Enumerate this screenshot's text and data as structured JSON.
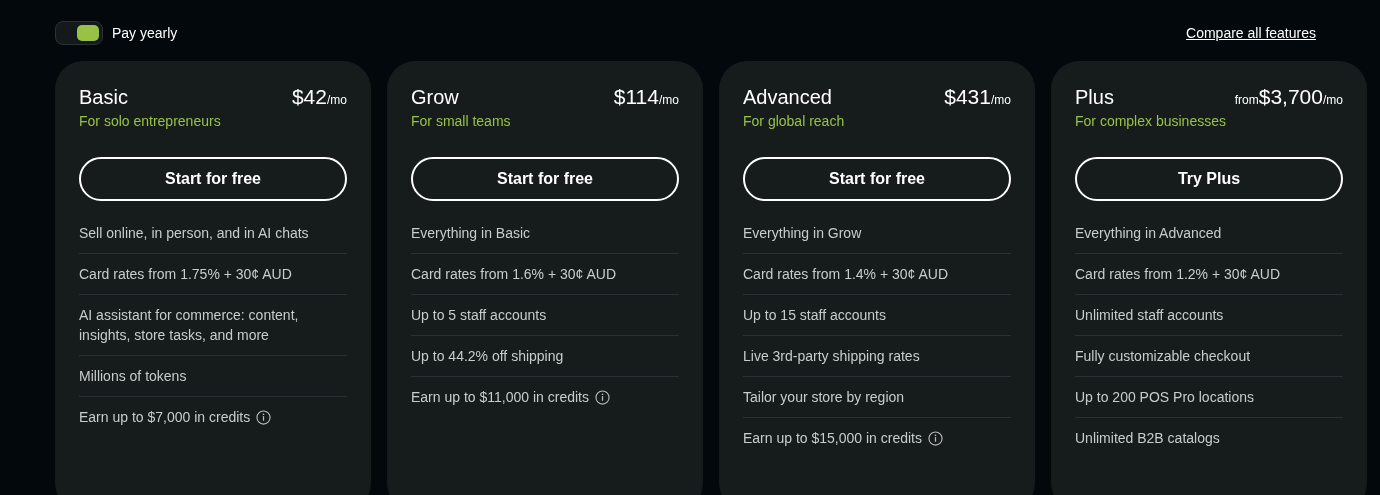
{
  "billing_toggle": {
    "label": "Pay yearly",
    "on": true
  },
  "compare_link": "Compare all features",
  "plans": [
    {
      "name": "Basic",
      "tagline": "For solo entrepreneurs",
      "price": "$42",
      "period": "/mo",
      "button": "Start for free",
      "features": [
        {
          "text": "Sell online, in person, and in AI chats",
          "info": false
        },
        {
          "text": "Card rates from 1.75% + 30¢ AUD",
          "info": false
        },
        {
          "text": "AI assistant for commerce: content, insights, store tasks, and more",
          "info": false
        },
        {
          "text": "Millions of tokens",
          "info": false
        },
        {
          "text": "Earn up to $7,000 in credits",
          "info": true
        }
      ]
    },
    {
      "name": "Grow",
      "tagline": "For small teams",
      "price": "$114",
      "period": "/mo",
      "button": "Start for free",
      "features": [
        {
          "text": "Everything in Basic",
          "info": false
        },
        {
          "text": "Card rates from 1.6% + 30¢ AUD",
          "info": false
        },
        {
          "text": "Up to 5 staff accounts",
          "info": false
        },
        {
          "text": "Up to 44.2% off shipping",
          "info": false
        },
        {
          "text": "Earn up to $11,000 in credits",
          "info": true
        }
      ]
    },
    {
      "name": "Advanced",
      "tagline": "For global reach",
      "price": "$431",
      "period": "/mo",
      "button": "Start for free",
      "features": [
        {
          "text": "Everything in Grow",
          "info": false
        },
        {
          "text": "Card rates from 1.4% + 30¢ AUD",
          "info": false
        },
        {
          "text": "Up to 15 staff accounts",
          "info": false
        },
        {
          "text": "Live 3rd-party shipping rates",
          "info": false
        },
        {
          "text": "Tailor your store by region",
          "info": false
        },
        {
          "text": "Earn up to $15,000 in credits",
          "info": true
        }
      ]
    },
    {
      "name": "Plus",
      "tagline": "For complex businesses",
      "price_prefix": "from",
      "price": "$3,700",
      "period": "/mo",
      "button": "Try Plus",
      "features": [
        {
          "text": "Everything in Advanced",
          "info": false
        },
        {
          "text": "Card rates from 1.2% + 30¢ AUD",
          "info": false
        },
        {
          "text": "Unlimited staff accounts",
          "info": false
        },
        {
          "text": "Fully customizable checkout",
          "info": false
        },
        {
          "text": "Up to 200 POS Pro locations",
          "info": false
        },
        {
          "text": "Unlimited B2B catalogs",
          "info": false
        }
      ]
    }
  ]
}
